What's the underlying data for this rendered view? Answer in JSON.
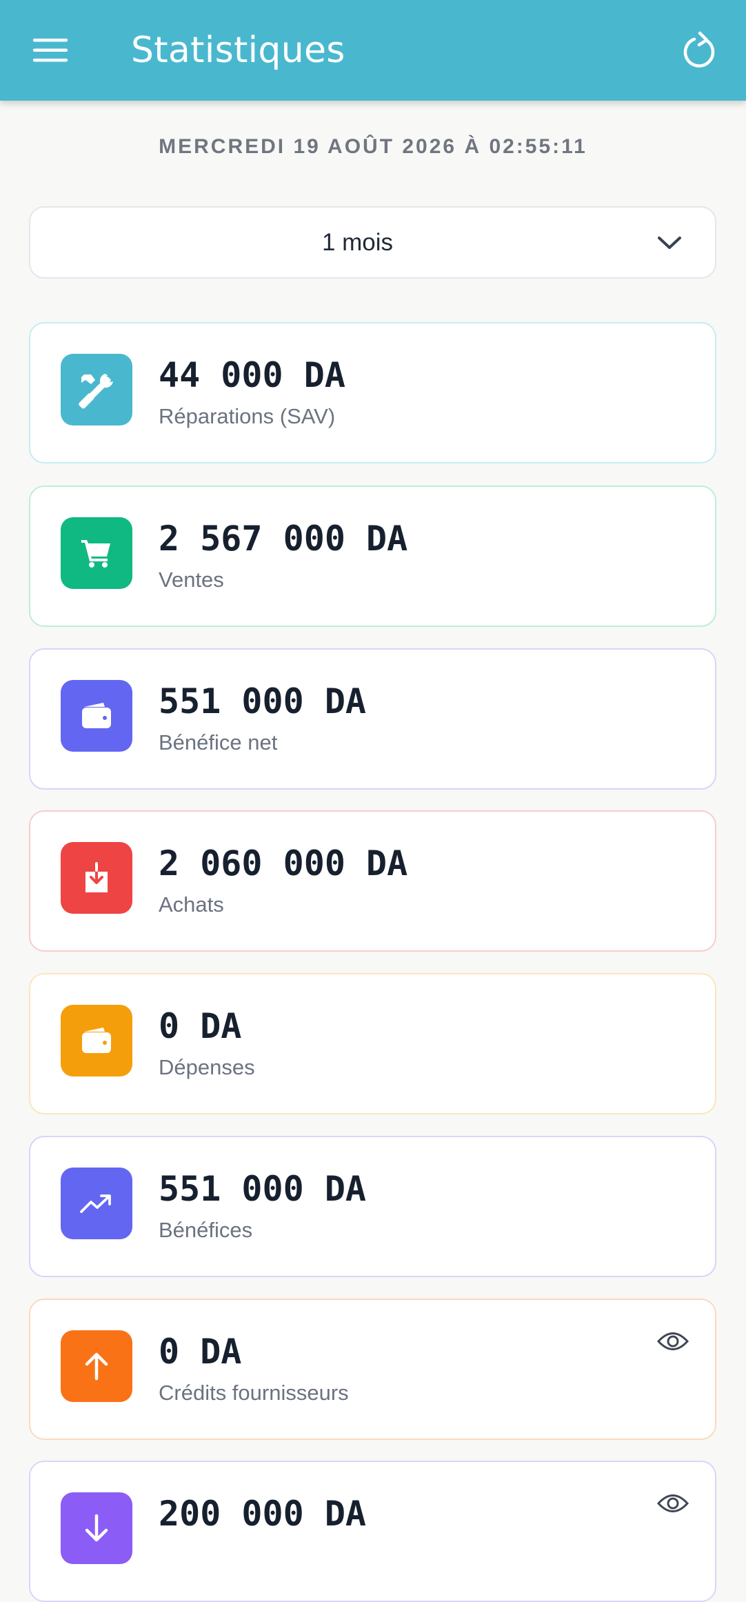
{
  "app_bar": {
    "title": "Statistiques",
    "color": "#49b8cf"
  },
  "date_line": "MERCREDI 19 AOÛT 2026 À 02:55:11",
  "period": {
    "selected": "1 mois"
  },
  "cards": [
    {
      "value": "44 000 DA",
      "label": "Réparations (SAV)",
      "icon": "tools-icon",
      "color": "#49b8cf",
      "border": "#c6ecf2"
    },
    {
      "value": "2 567 000 DA",
      "label": "Ventes",
      "icon": "cart-icon",
      "color": "#10b981",
      "border": "#bdeed9"
    },
    {
      "value": "551 000 DA",
      "label": "Bénéfice net",
      "icon": "wallet-icon",
      "color": "#6366f1",
      "border": "#d5d6fa"
    },
    {
      "value": "2 060 000 DA",
      "label": "Achats",
      "icon": "download-box-icon",
      "color": "#ef4444",
      "border": "#f8cccc"
    },
    {
      "value": "0 DA",
      "label": "Dépenses",
      "icon": "wallet-icon",
      "color": "#f59e0b",
      "border": "#fbe6bd"
    },
    {
      "value": "551 000 DA",
      "label": "Bénéfices",
      "icon": "trending-up-icon",
      "color": "#6366f1",
      "border": "#d5d6fa"
    },
    {
      "value": "0 DA",
      "label": "Crédits fournisseurs",
      "icon": "arrow-up-icon",
      "color": "#f97316",
      "border": "#fcd9bd",
      "has_eye": true
    },
    {
      "value": "200 000 DA",
      "label": "",
      "icon": "arrow-down-icon",
      "color": "#8b5cf6",
      "border": "#ddd3fb",
      "has_eye": true
    }
  ]
}
